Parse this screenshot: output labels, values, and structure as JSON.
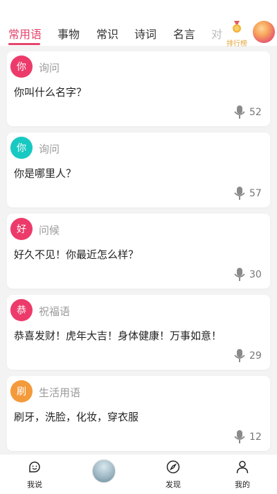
{
  "tabs": [
    "常用语",
    "事物",
    "常识",
    "诗词",
    "名言",
    "对"
  ],
  "rank_label": "排行榜",
  "cards": [
    {
      "badge": "你",
      "color": "#ec3b6b",
      "category": "询问",
      "sentence": "你叫什么名字？",
      "count": "52"
    },
    {
      "badge": "你",
      "color": "#18c9c2",
      "category": "询问",
      "sentence": "你是哪里人？",
      "count": "57"
    },
    {
      "badge": "好",
      "color": "#ec3b6b",
      "category": "问候",
      "sentence": "好久不见！你最近怎么样？",
      "count": "30"
    },
    {
      "badge": "恭",
      "color": "#ec3b6b",
      "category": "祝福语",
      "sentence": "恭喜发财！虎年大吉！身体健康！万事如意！",
      "count": "29"
    },
    {
      "badge": "刷",
      "color": "#f39a3b",
      "category": "生活用语",
      "sentence": "刷牙，洗脸，化妆，穿衣服",
      "count": "12"
    }
  ],
  "nav": {
    "speak": "我说",
    "discover": "发现",
    "mine": "我的"
  },
  "colors": {
    "accent": "#e6446c",
    "gold": "#e5a63d"
  },
  "icons": [
    "medal-icon",
    "mic-icon",
    "smile-face-icon",
    "compass-icon",
    "person-icon"
  ]
}
